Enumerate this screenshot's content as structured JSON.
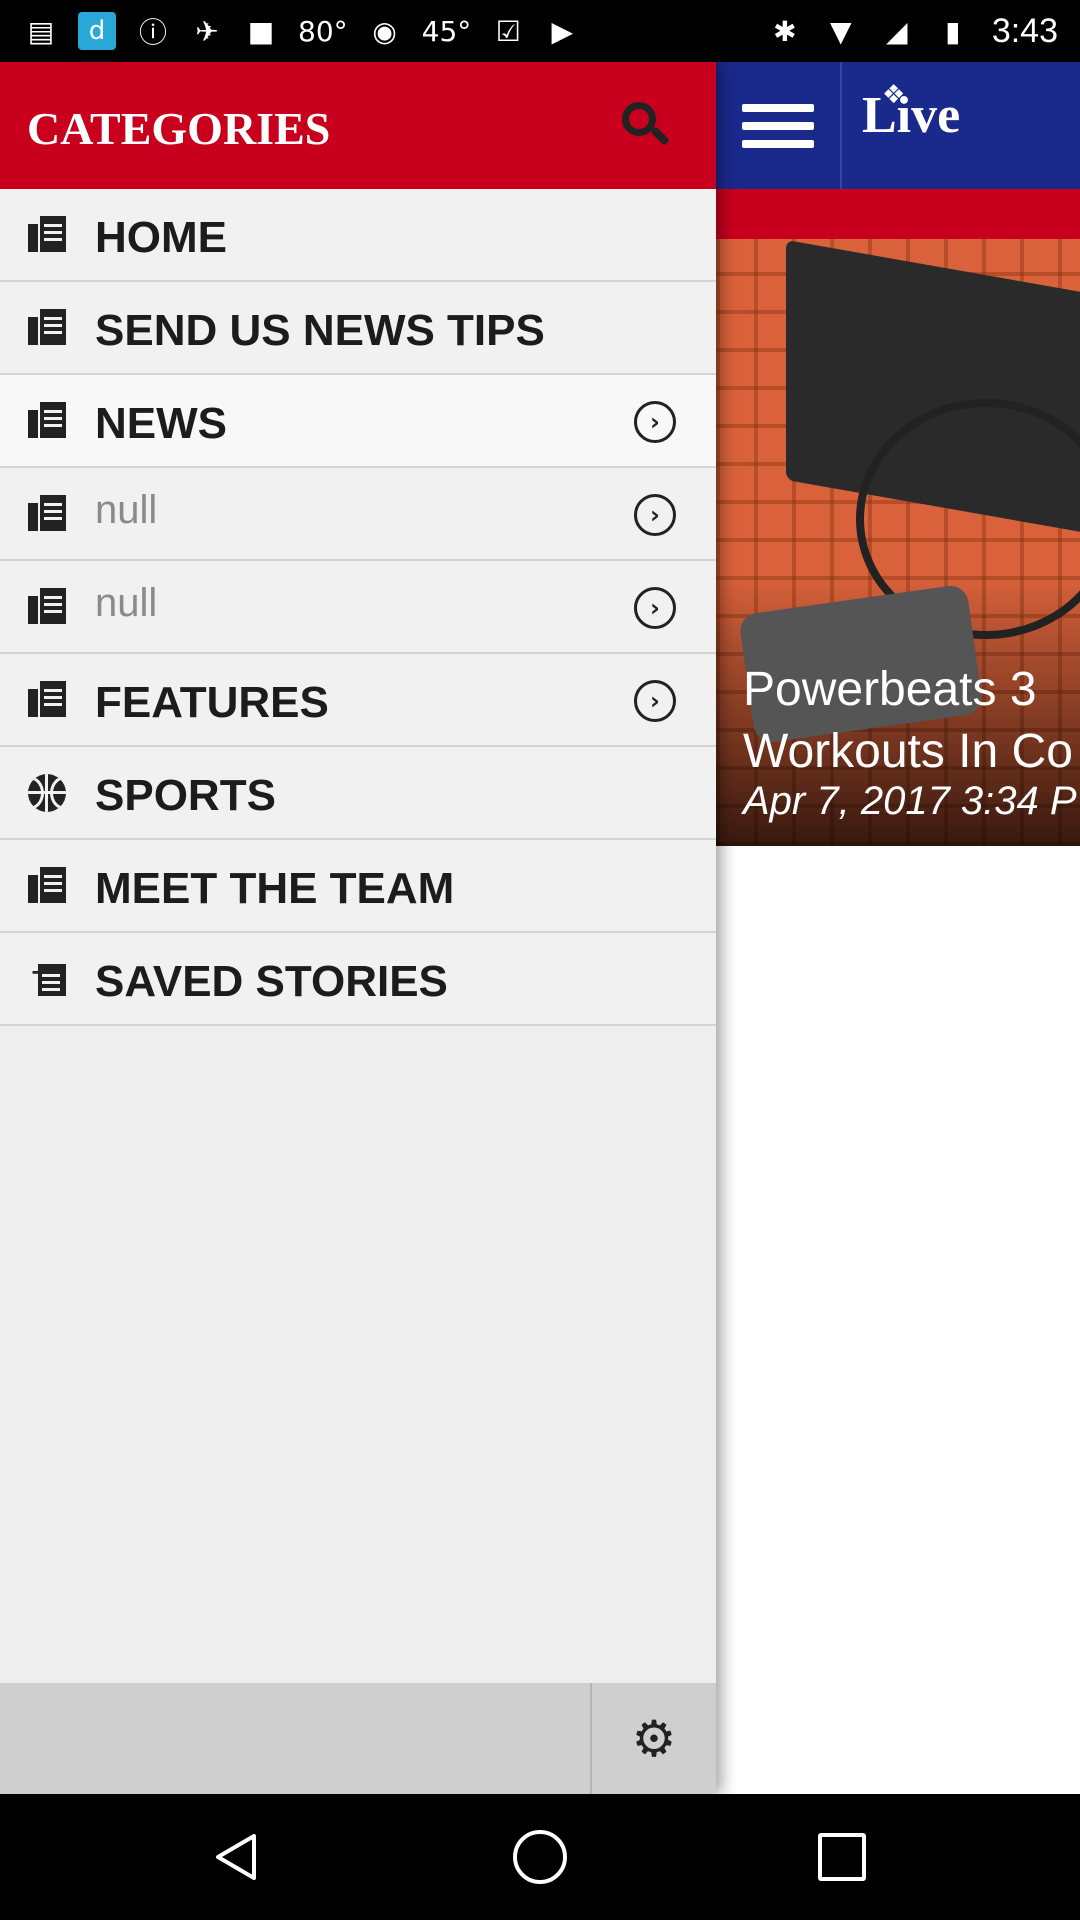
{
  "status_bar": {
    "temp1": "80°",
    "temp2": "45°",
    "time": "3:43",
    "icons": [
      "message-icon",
      "app-icon",
      "info-icon",
      "satellite-icon",
      "lock-icon",
      "android-icon",
      "check-icon",
      "play-icon",
      "bluetooth-icon",
      "wifi-icon",
      "signal-icon",
      "battery-icon"
    ]
  },
  "drawer": {
    "title": "CATEGORIES",
    "items": [
      {
        "label": "HOME",
        "icon": "document-icon",
        "has_chevron": false,
        "style": "bold"
      },
      {
        "label": "SEND US NEWS TIPS",
        "icon": "document-icon",
        "has_chevron": false,
        "style": "bold"
      },
      {
        "label": "NEWS",
        "icon": "document-icon",
        "has_chevron": true,
        "style": "bold"
      },
      {
        "label": "null",
        "icon": "document-icon",
        "has_chevron": true,
        "style": "light"
      },
      {
        "label": "null",
        "icon": "document-icon",
        "has_chevron": true,
        "style": "light"
      },
      {
        "label": "FEATURES",
        "icon": "document-icon",
        "has_chevron": true,
        "style": "bold"
      },
      {
        "label": "SPORTS",
        "icon": "basketball-icon",
        "has_chevron": false,
        "style": "bold"
      },
      {
        "label": "MEET THE TEAM",
        "icon": "document-icon",
        "has_chevron": false,
        "style": "bold"
      },
      {
        "label": "SAVED STORIES",
        "icon": "saved-icon",
        "has_chevron": false,
        "style": "bold"
      }
    ]
  },
  "content": {
    "logo": "Live",
    "hero_title_line1": "Powerbeats 3",
    "hero_title_line2": "Workouts In Co",
    "hero_date": "Apr 7, 2017 3:34 P"
  },
  "colors": {
    "drawer_header": "#c8001e",
    "content_topbar": "#1a2a8c",
    "drawer_bg": "#eeeeee"
  }
}
